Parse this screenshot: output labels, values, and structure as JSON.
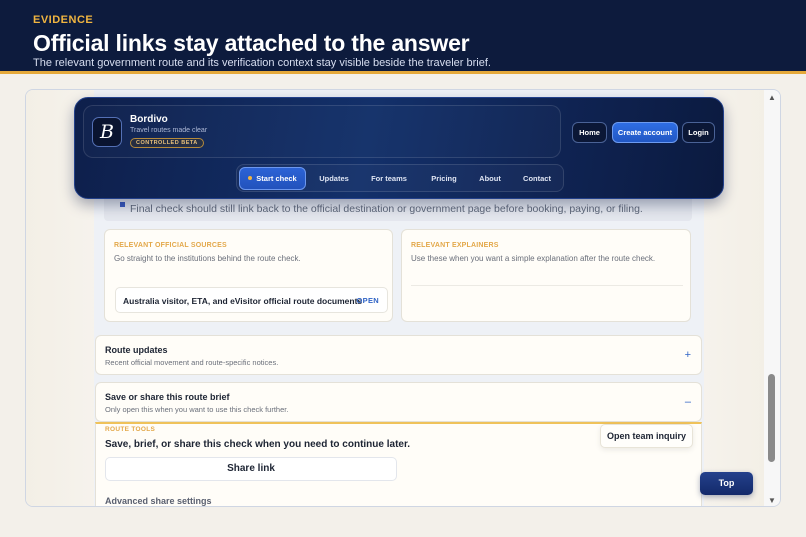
{
  "banner": {
    "eyebrow": "EVIDENCE",
    "headline": "Official links stay attached to the answer",
    "subline": "The relevant government route and its verification context stay visible beside the traveler brief."
  },
  "nav": {
    "logo_letter": "B",
    "brand_name": "Bordivo",
    "tagline": "Travel routes made clear",
    "beta_badge": "CONTROLLED BETA",
    "home": "Home",
    "create_account": "Create account",
    "login": "Login",
    "tabs": [
      "Start check",
      "Updates",
      "For teams",
      "Pricing",
      "About",
      "Contact"
    ],
    "active_tab": "Start check"
  },
  "notice": {
    "text": "Final check should still link back to the official destination or government page before booking, paying, or filing."
  },
  "sources": {
    "title": "RELEVANT OFFICIAL SOURCES",
    "subtitle": "Go straight to the institutions behind the route check.",
    "link_label": "Australia visitor, ETA, and eVisitor official route documents",
    "link_action": "OPEN"
  },
  "explainers": {
    "title": "RELEVANT EXPLAINERS",
    "subtitle": "Use these when you want a simple explanation after the route check."
  },
  "route_updates": {
    "title": "Route updates",
    "subtitle": "Recent official movement and route-specific notices.",
    "icon": "+"
  },
  "save_share": {
    "title": "Save or share this route brief",
    "subtitle": "Only open this when you want to use this check further.",
    "icon": "–"
  },
  "tools": {
    "eyebrow": "ROUTE TOOLS",
    "title": "Save, brief, or share this check when you need to continue later.",
    "share_button": "Share link",
    "advanced": "Advanced share settings"
  },
  "floating": {
    "team_inquiry": "Open team inquiry",
    "top": "Top"
  },
  "colors": {
    "navy": "#0d1b3d",
    "accent_gold": "#f0b540",
    "primary_blue": "#2f6ee4"
  }
}
